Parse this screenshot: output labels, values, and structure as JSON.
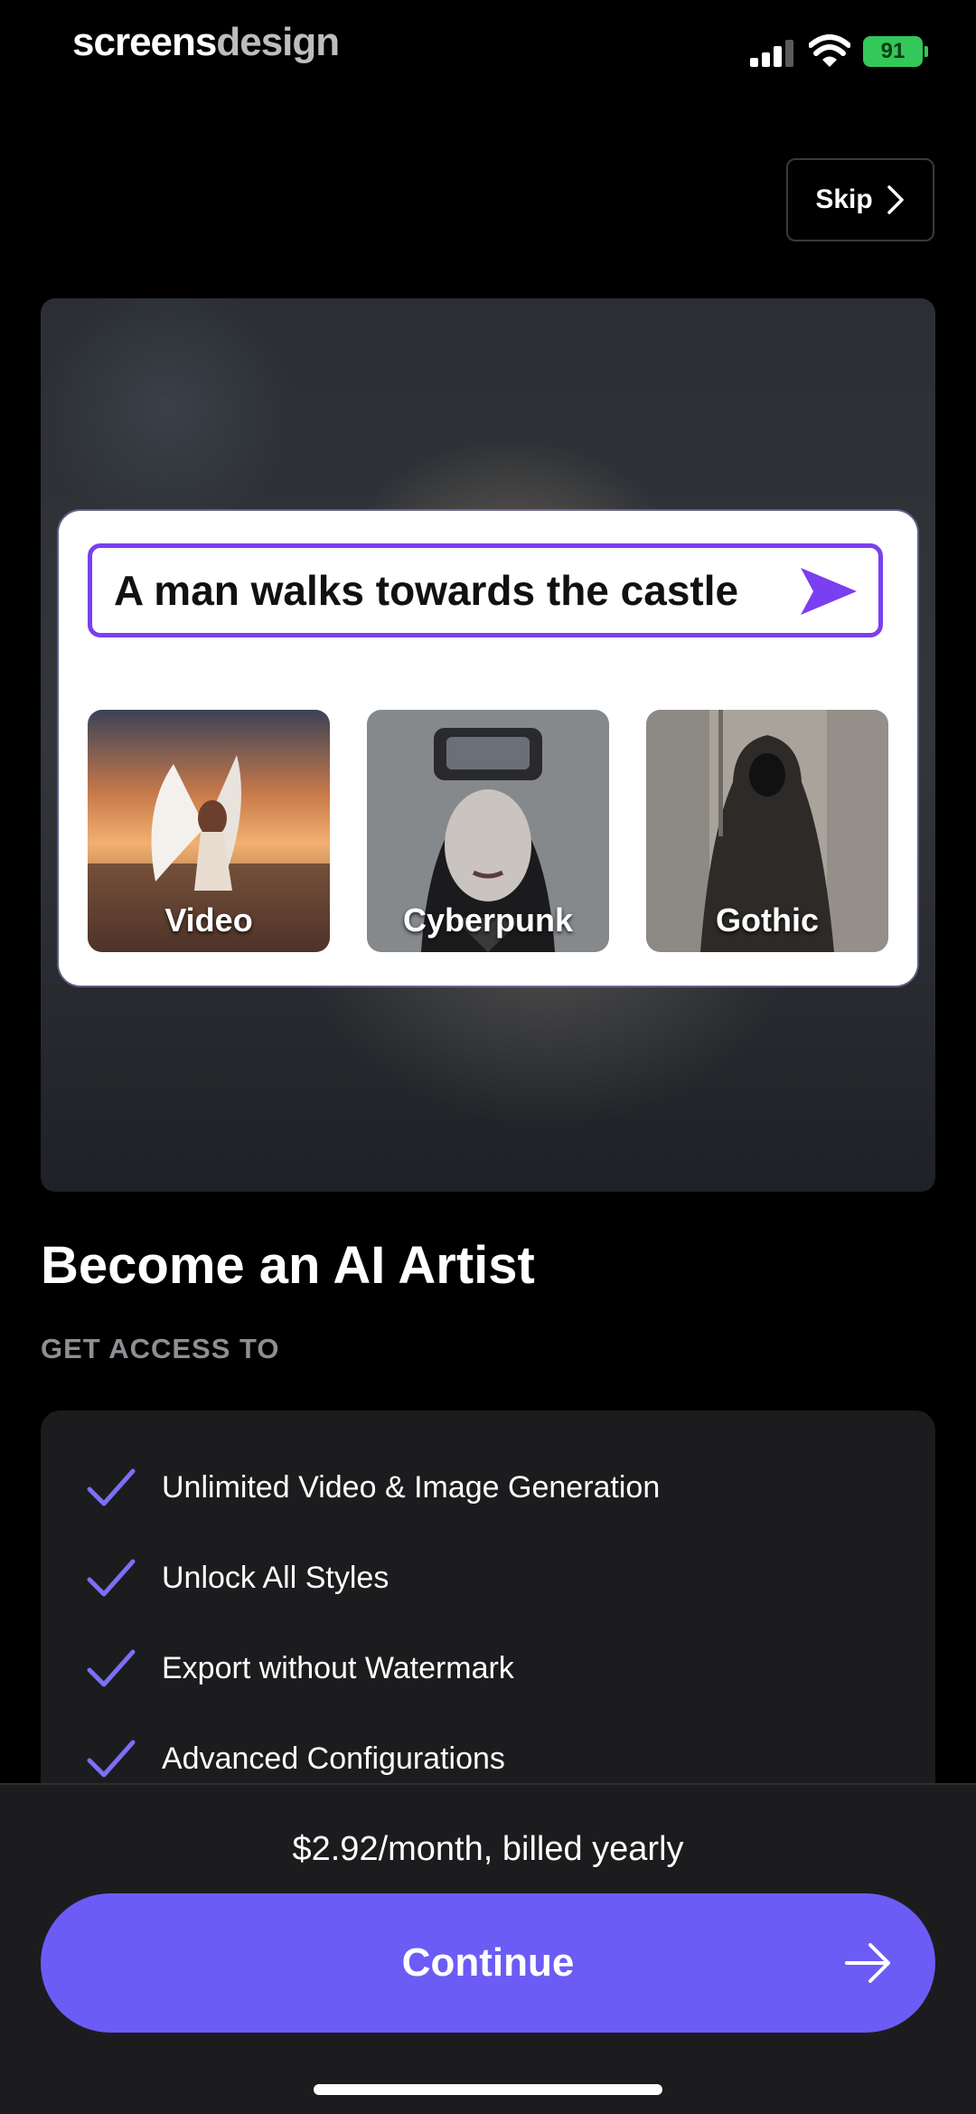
{
  "status_bar": {
    "brand_part1": "screens",
    "brand_part2": "design",
    "battery": "91"
  },
  "header": {
    "skip_label": "Skip"
  },
  "hero": {
    "prompt_text": "A man walks towards the castle",
    "styles": [
      {
        "label": "Video"
      },
      {
        "label": "Cyberpunk"
      },
      {
        "label": "Gothic"
      }
    ]
  },
  "content": {
    "title": "Become an AI Artist",
    "subtitle": "GET ACCESS TO",
    "features": [
      "Unlimited Video & Image Generation",
      "Unlock All Styles",
      "Export without Watermark",
      "Advanced Configurations"
    ]
  },
  "footer": {
    "price": "$2.92/month, billed yearly",
    "continue_label": "Continue"
  },
  "colors": {
    "accent": "#6b5cf6",
    "prompt_border": "#7a3ff0",
    "check": "#7b6ff7",
    "battery": "#34c759"
  }
}
